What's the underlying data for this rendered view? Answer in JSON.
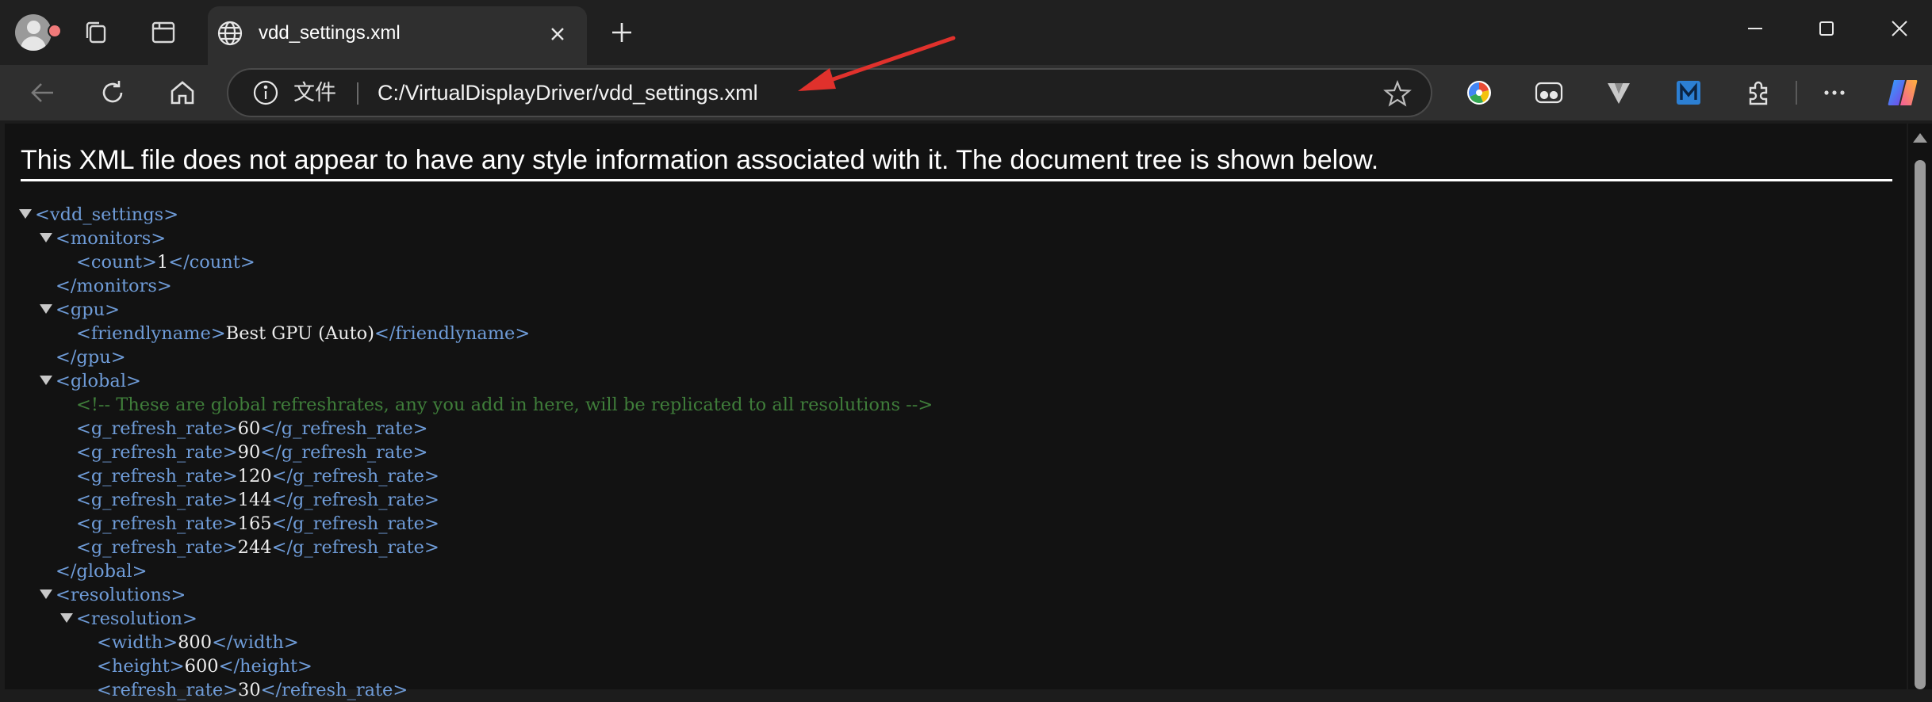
{
  "browser": {
    "tab": {
      "title": "vdd_settings.xml"
    },
    "address": {
      "label": "文件",
      "url": "C:/VirtualDisplayDriver/vdd_settings.xml"
    },
    "colors": {
      "accent_arrow": "#e0312c",
      "tag": "#6f9cd8",
      "comment": "#3f7d3a"
    }
  },
  "page": {
    "header": "This XML file does not appear to have any style information associated with it. The document tree is shown below."
  },
  "xml_lines": [
    {
      "indent": 0,
      "toggle": true,
      "open": "<vdd_settings>",
      "value": "",
      "close": ""
    },
    {
      "indent": 1,
      "toggle": true,
      "open": "<monitors>",
      "value": "",
      "close": ""
    },
    {
      "indent": 2,
      "toggle": false,
      "open": "<count>",
      "value": "1",
      "close": "</count>"
    },
    {
      "indent": 1,
      "toggle": false,
      "open": "</monitors>",
      "value": "",
      "close": ""
    },
    {
      "indent": 1,
      "toggle": true,
      "open": "<gpu>",
      "value": "",
      "close": ""
    },
    {
      "indent": 2,
      "toggle": false,
      "open": "<friendlyname>",
      "value": "Best GPU (Auto)",
      "close": "</friendlyname>"
    },
    {
      "indent": 1,
      "toggle": false,
      "open": "</gpu>",
      "value": "",
      "close": ""
    },
    {
      "indent": 1,
      "toggle": true,
      "open": "<global>",
      "value": "",
      "close": ""
    },
    {
      "indent": 2,
      "toggle": false,
      "comment": "<!-- These are global refreshrates, any you add in here, will be replicated to all resolutions -->"
    },
    {
      "indent": 2,
      "toggle": false,
      "open": "<g_refresh_rate>",
      "value": "60",
      "close": "</g_refresh_rate>"
    },
    {
      "indent": 2,
      "toggle": false,
      "open": "<g_refresh_rate>",
      "value": "90",
      "close": "</g_refresh_rate>"
    },
    {
      "indent": 2,
      "toggle": false,
      "open": "<g_refresh_rate>",
      "value": "120",
      "close": "</g_refresh_rate>"
    },
    {
      "indent": 2,
      "toggle": false,
      "open": "<g_refresh_rate>",
      "value": "144",
      "close": "</g_refresh_rate>"
    },
    {
      "indent": 2,
      "toggle": false,
      "open": "<g_refresh_rate>",
      "value": "165",
      "close": "</g_refresh_rate>"
    },
    {
      "indent": 2,
      "toggle": false,
      "open": "<g_refresh_rate>",
      "value": "244",
      "close": "</g_refresh_rate>"
    },
    {
      "indent": 1,
      "toggle": false,
      "open": "</global>",
      "value": "",
      "close": ""
    },
    {
      "indent": 1,
      "toggle": true,
      "open": "<resolutions>",
      "value": "",
      "close": ""
    },
    {
      "indent": 2,
      "toggle": true,
      "open": "<resolution>",
      "value": "",
      "close": ""
    },
    {
      "indent": 3,
      "toggle": false,
      "open": "<width>",
      "value": "800",
      "close": "</width>"
    },
    {
      "indent": 3,
      "toggle": false,
      "open": "<height>",
      "value": "600",
      "close": "</height>"
    },
    {
      "indent": 3,
      "toggle": false,
      "open": "<refresh_rate>",
      "value": "30",
      "close": "</refresh_rate>"
    }
  ]
}
